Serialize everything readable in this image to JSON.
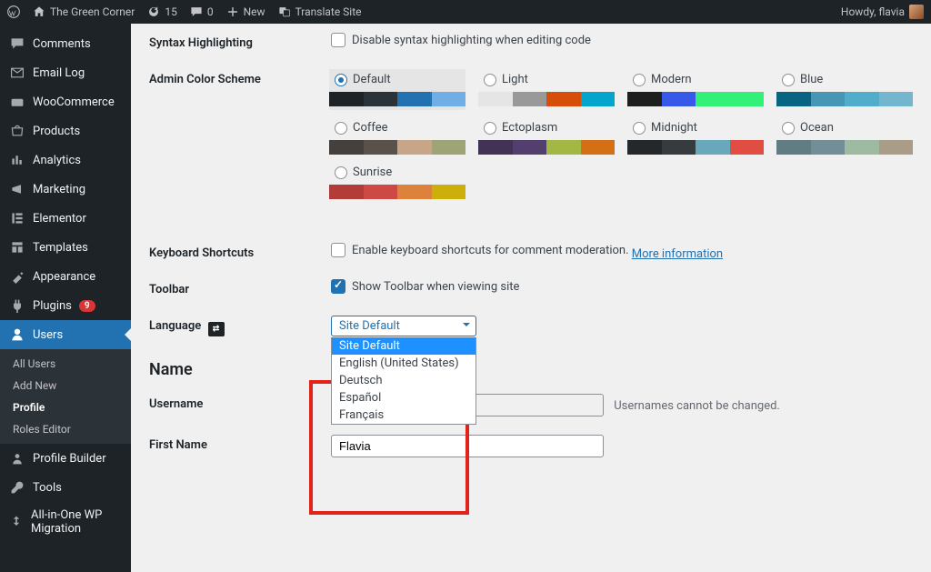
{
  "adminbar": {
    "site_name": "The Green Corner",
    "updates": "15",
    "comments": "0",
    "new": "New",
    "translate": "Translate Site",
    "howdy": "Howdy, flavia"
  },
  "sidebar": {
    "items": [
      {
        "label": "Comments"
      },
      {
        "label": "Email Log"
      },
      {
        "label": "WooCommerce"
      },
      {
        "label": "Products"
      },
      {
        "label": "Analytics"
      },
      {
        "label": "Marketing"
      },
      {
        "label": "Elementor"
      },
      {
        "label": "Templates"
      },
      {
        "label": "Appearance"
      },
      {
        "label": "Plugins",
        "badge": "9"
      },
      {
        "label": "Users",
        "current": true
      },
      {
        "label": "Profile Builder"
      },
      {
        "label": "Tools"
      },
      {
        "label": "All-in-One WP Migration"
      }
    ],
    "submenu": [
      {
        "label": "All Users"
      },
      {
        "label": "Add New"
      },
      {
        "label": "Profile",
        "current": true
      },
      {
        "label": "Roles Editor"
      }
    ]
  },
  "form": {
    "syntax_label": "Syntax Highlighting",
    "syntax_check": "Disable syntax highlighting when editing code",
    "scheme_label": "Admin Color Scheme",
    "shortcuts_label": "Keyboard Shortcuts",
    "shortcuts_check": "Enable keyboard shortcuts for comment moderation.",
    "shortcuts_link": "More information",
    "toolbar_label": "Toolbar",
    "toolbar_check": "Show Toolbar when viewing site",
    "language_label": "Language",
    "language_value": "Site Default",
    "language_options": [
      "Site Default",
      "English (United States)",
      "Deutsch",
      "Español",
      "Français"
    ],
    "name_heading": "Name",
    "username_label": "Username",
    "username_hint": "Usernames cannot be changed.",
    "firstname_label": "First Name",
    "firstname_value": "Flavia"
  },
  "schemes": [
    {
      "name": "Default",
      "colors": [
        "#1d2327",
        "#2c3338",
        "#2271b1",
        "#72aee6"
      ],
      "selected": true
    },
    {
      "name": "Light",
      "colors": [
        "#e5e5e5",
        "#999999",
        "#d64e07",
        "#04a4cc"
      ]
    },
    {
      "name": "Modern",
      "colors": [
        "#1e1e1e",
        "#3858e9",
        "#33f078",
        "#33f078"
      ]
    },
    {
      "name": "Blue",
      "colors": [
        "#096484",
        "#4796b3",
        "#52accc",
        "#74B6CE"
      ]
    },
    {
      "name": "Coffee",
      "colors": [
        "#46403c",
        "#59524c",
        "#c7a589",
        "#9ea476"
      ]
    },
    {
      "name": "Ectoplasm",
      "colors": [
        "#413256",
        "#523f6d",
        "#a3b745",
        "#d46f15"
      ]
    },
    {
      "name": "Midnight",
      "colors": [
        "#25282b",
        "#363b3f",
        "#69a8bb",
        "#e14d43"
      ]
    },
    {
      "name": "Ocean",
      "colors": [
        "#627c83",
        "#738e96",
        "#9ebaa0",
        "#aa9d88"
      ]
    },
    {
      "name": "Sunrise",
      "colors": [
        "#b43c38",
        "#cf4944",
        "#dd823b",
        "#ccaf0b"
      ]
    }
  ]
}
